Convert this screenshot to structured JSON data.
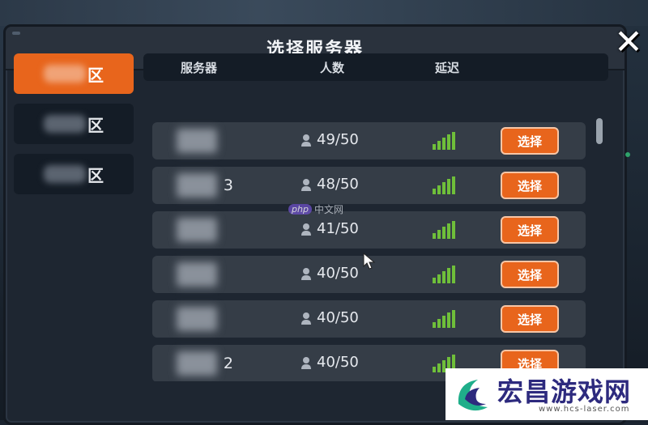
{
  "dialog": {
    "title": "选择服务器",
    "close_label": "✕"
  },
  "regions": [
    {
      "suffix": "区",
      "active": true
    },
    {
      "suffix": "区",
      "active": false
    },
    {
      "suffix": "区",
      "active": false
    }
  ],
  "table": {
    "headers": {
      "server": "服务器",
      "players": "人数",
      "latency": "延迟"
    }
  },
  "servers": [
    {
      "name_suffix": "",
      "players": "49/50",
      "button": "选择"
    },
    {
      "name_suffix": "3",
      "players": "48/50",
      "button": "选择"
    },
    {
      "name_suffix": "",
      "players": "41/50",
      "button": "选择"
    },
    {
      "name_suffix": "",
      "players": "40/50",
      "button": "选择"
    },
    {
      "name_suffix": "",
      "players": "40/50",
      "button": "选择"
    },
    {
      "name_suffix": "2",
      "players": "40/50",
      "button": "选择"
    }
  ],
  "colors": {
    "accent": "#e8651c",
    "signal": "#6fbf3a",
    "panel": "#1e2631",
    "row": "#353d47"
  },
  "watermarks": {
    "center_tag": "php",
    "center_text": "中文网",
    "logo_text": "宏昌游戏网",
    "logo_url": "www.hcs-laser.com"
  }
}
